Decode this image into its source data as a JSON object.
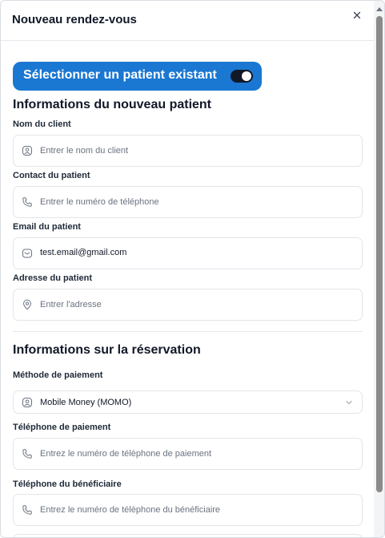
{
  "modal": {
    "title": "Nouveau rendez-vous",
    "close_icon": "close-icon"
  },
  "toggle": {
    "label": "Sélectionner un patient existant",
    "checked": true,
    "accent": "#1a77d2"
  },
  "new_patient": {
    "title": "Informations du nouveau patient",
    "fields": [
      {
        "label": "Nom du client",
        "placeholder": "Entrer le nom du client",
        "value": "",
        "icon": "user-icon"
      },
      {
        "label": "Contact du patient",
        "placeholder": "Entrer le numéro de téléphone",
        "value": "",
        "icon": "phone-icon"
      },
      {
        "label": "Email du patient",
        "placeholder": "",
        "value": "test.email@gmail.com",
        "icon": "email-icon"
      },
      {
        "label": "Adresse du patient",
        "placeholder": "Entrer l'adresse",
        "value": "",
        "icon": "location-icon"
      }
    ]
  },
  "reservation": {
    "title": "Informations sur la réservation",
    "payment_method": {
      "label": "Méthode de paiement",
      "value": "Mobile Money (MOMO)",
      "icon": "user-icon"
    },
    "payment_phone": {
      "label": "Téléphone de paiement",
      "placeholder": "Entrez le numéro de téléphone de paiement",
      "icon": "phone-icon"
    },
    "beneficiary_phone": {
      "label": "Téléphone du bénéficiaire",
      "placeholder": "Entrez le numéro de téléphone du bénéficiaire",
      "icon": "phone-icon"
    }
  }
}
